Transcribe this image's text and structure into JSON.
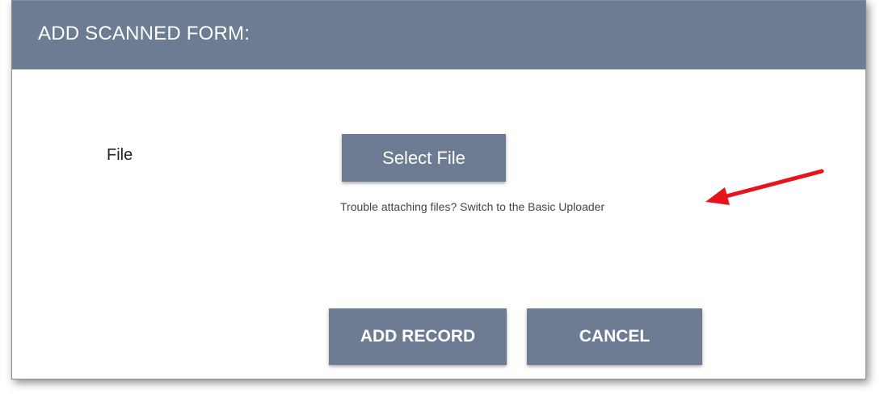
{
  "header": {
    "title": "ADD SCANNED FORM:"
  },
  "form": {
    "file_label": "File",
    "select_file_label": "Select File",
    "uploader_hint": "Trouble attaching files? Switch to the Basic Uploader"
  },
  "actions": {
    "add_record_label": "ADD RECORD",
    "cancel_label": "CANCEL"
  },
  "colors": {
    "header_bg": "#6d7b93",
    "button_bg": "#6d7b93",
    "annotation_arrow": "#e8141b"
  },
  "icons": {
    "annotation": "red-arrow-icon"
  }
}
